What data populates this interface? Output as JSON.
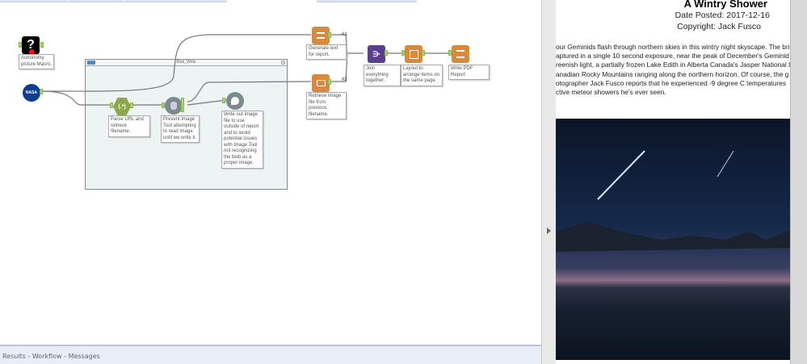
{
  "workflow": {
    "container_title": "Blob_Write",
    "notes": {
      "macro": "Astronomy picture Macro.",
      "parse": "Parse URL and retrieve filename.",
      "prevent": "Prevent Image Tool attempting to read image until we write it.",
      "write_blob": "Write out image file to use outside of report and to avoid potential issues with Image Tool not recognizing the blob as a proper image.",
      "gen_text": "Generate text for report.",
      "retrieve": "Retrieve image file from previous filename.",
      "join": "Join everything together.",
      "layout": "Layout to arrange items on the same page.",
      "pdf": "Write PDF Report"
    },
    "labels": {
      "conn1": "#1",
      "conn2": "#2",
      "regex": "(.*)",
      "nasa": "NASA",
      "macro_icon": "?"
    }
  },
  "bottom_bar": {
    "label": "Results - Workflow - Messages"
  },
  "preview": {
    "title": "A Wintry Shower",
    "date": "Date Posted: 2017-12-16",
    "copyright": "Copyright: Jack Fusco",
    "lines": [
      "our Geminids flash through northern skies in this wintry night skyscape. The bri",
      "aptured in a single 10 second exposure, near the peak of December's Geminid",
      "reenish light, a partially frozen Lake Edith in Alberta Canada's Jasper National I",
      "anadian Rocky Mountains ranging along the northern horizon. Of course, the g",
      "otographer Jack Fusco reports that he experienced -9 degree C temperatures",
      "ctive meteor showers he's ever seen."
    ]
  },
  "colors": {
    "report_tool": "#d9893b",
    "join_tool": "#5b3e8e",
    "regex_tool": "#8aa84a",
    "accent_anchor": "#a6d36b"
  }
}
